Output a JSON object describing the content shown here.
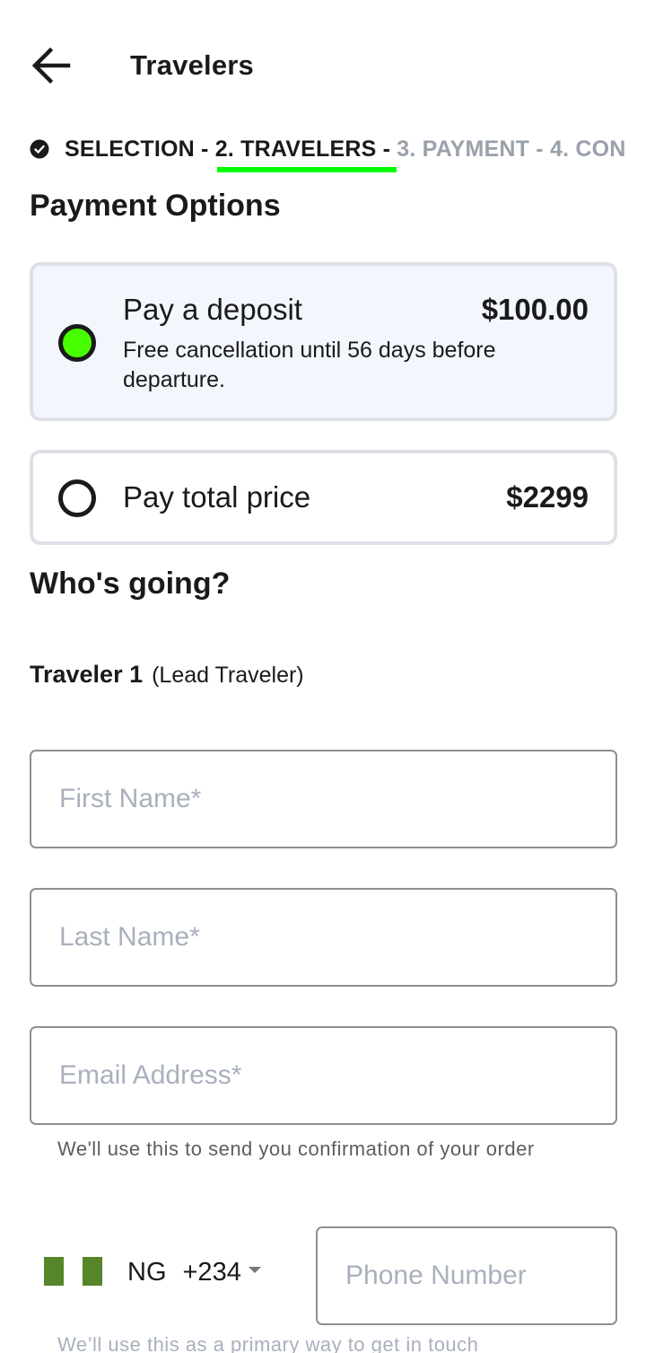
{
  "header": {
    "title": "Travelers",
    "back_icon": "arrow-left-icon"
  },
  "stepper": {
    "check_icon": "check-circle-icon",
    "steps": [
      {
        "label": "SELECTION",
        "state": "done"
      },
      {
        "label": "2. TRAVELERS",
        "state": "active"
      },
      {
        "label": "3. PAYMENT",
        "state": "future"
      },
      {
        "label": "4. CON",
        "state": "future"
      }
    ],
    "separator": " - ",
    "active_color": "#00ff00"
  },
  "payment": {
    "title": "Payment Options",
    "options": [
      {
        "label": "Pay a deposit",
        "price": "$100.00",
        "subtitle": "Free cancellation until 56 days before departure.",
        "selected": true
      },
      {
        "label": "Pay total price",
        "price": "$2299",
        "selected": false
      }
    ],
    "selected_color": "#48ff00"
  },
  "travelers": {
    "title": "Who's going?",
    "traveler": {
      "name": "Traveler 1",
      "role": "(Lead Traveler)"
    },
    "fields": {
      "first_name": {
        "value": "",
        "placeholder": "First Name*"
      },
      "last_name": {
        "value": "",
        "placeholder": "Last Name*"
      },
      "email": {
        "value": "",
        "placeholder": "Email Address*",
        "helper": "We'll use this to send you confirmation of your order"
      },
      "phone": {
        "country": "NG",
        "dial_code": "+234",
        "flag_icon": "nigeria-flag-icon",
        "value": "",
        "placeholder": "Phone Number",
        "helper": "We’ll use this as a primary way to get in touch"
      }
    }
  }
}
